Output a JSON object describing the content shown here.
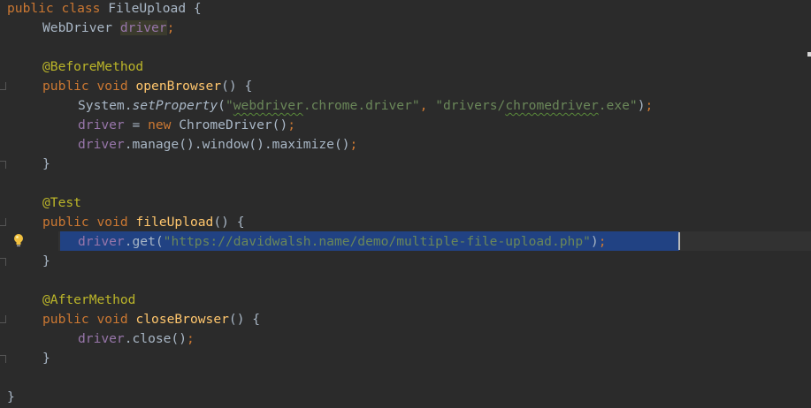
{
  "editor": {
    "class_decl": {
      "kw1": "public",
      "kw2": "class",
      "name": "FileUpload",
      "brace": "{"
    },
    "field_decl": {
      "type": "WebDriver",
      "name": "driver",
      "semi": ";"
    },
    "before_method": {
      "annotation": "@BeforeMethod",
      "kw1": "public",
      "kw2": "void",
      "name": "openBrowser",
      "sig": "() {",
      "set_property": {
        "receiver": "System.",
        "method": "setProperty",
        "open": "(",
        "arg1_q1": "\"",
        "arg1_a": "webdriver",
        "arg1_b": ".chrome.driver",
        "arg1_q2": "\"",
        "comma": ", ",
        "arg2_a": "\"drivers/",
        "arg2_b": "chromedriver",
        "arg2_c": ".exe\"",
        "close": ")",
        "semi": ";"
      },
      "assign": {
        "field": "driver",
        "eq": " = ",
        "kw": "new",
        "cls": " ChromeDriver()",
        "semi": ";"
      },
      "maximize": {
        "field": "driver",
        "rest": ".manage().window().maximize()",
        "semi": ";"
      },
      "close_brace": "}"
    },
    "test_method": {
      "annotation": "@Test",
      "kw1": "public",
      "kw2": "void",
      "name": "fileUpload",
      "sig": "() {",
      "get_call": {
        "field": "driver",
        "method": ".get(",
        "url": "\"https://davidwalsh.name/demo/multiple-file-upload.php\"",
        "close": ")",
        "semi": ";"
      },
      "close_brace": "}"
    },
    "after_method": {
      "annotation": "@AfterMethod",
      "kw1": "public",
      "kw2": "void",
      "name": "closeBrowser",
      "sig": "() {",
      "close_call": {
        "field": "driver",
        "rest": ".close()",
        "semi": ";"
      },
      "close_brace": "}"
    },
    "class_close": "}"
  },
  "colors": {
    "background": "#2b2b2b",
    "keyword": "#cc7832",
    "annotation": "#bbb529",
    "field": "#9876aa",
    "method_decl": "#ffc66d",
    "string": "#6a8759",
    "plain": "#a9b7c6",
    "selection": "#214283"
  },
  "icons": {
    "gutter_hint": "lightbulb-icon"
  }
}
